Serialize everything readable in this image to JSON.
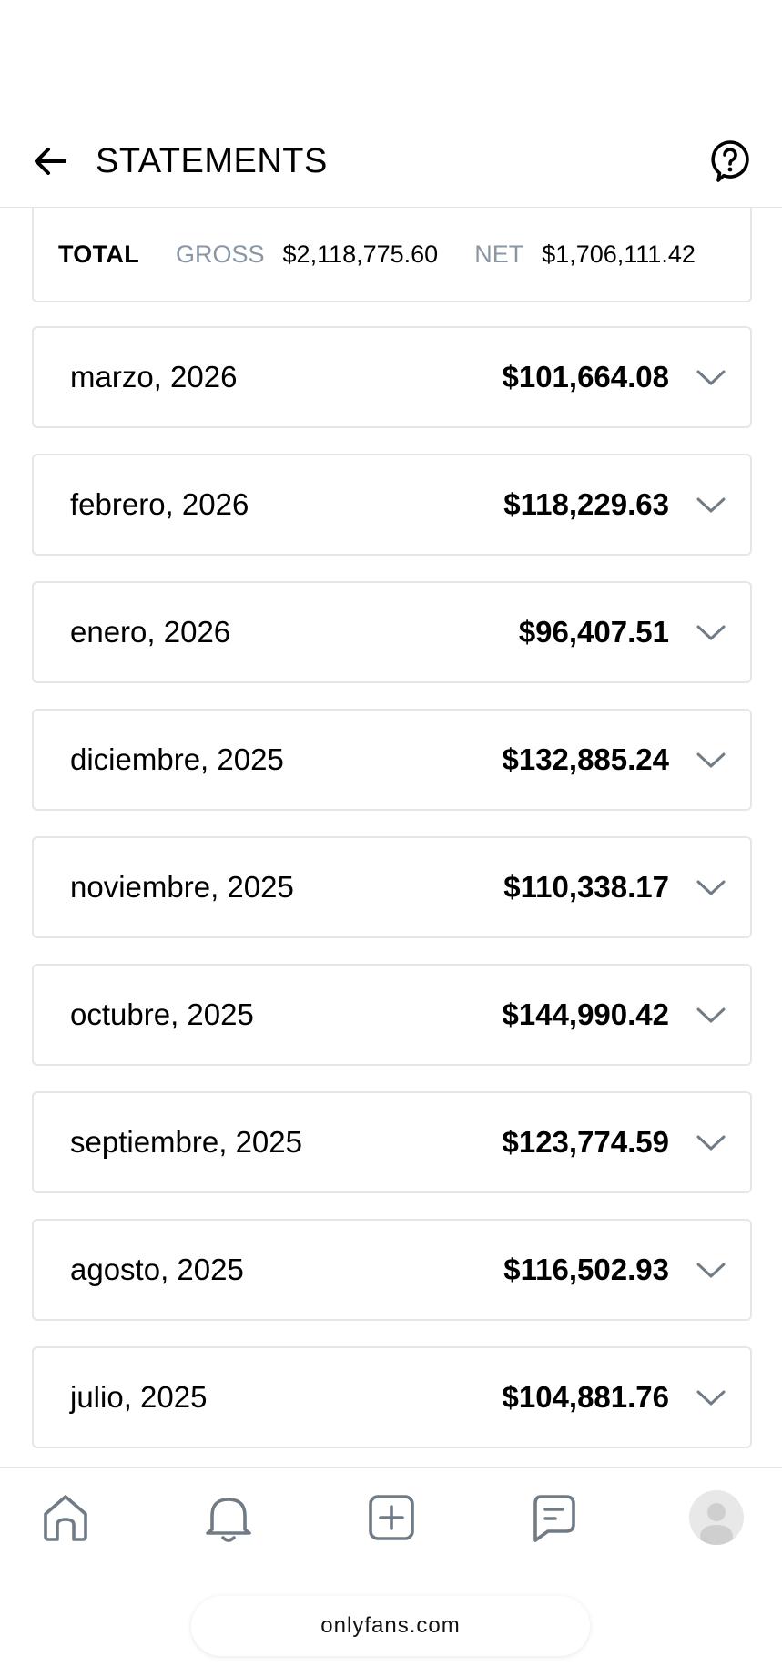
{
  "header": {
    "title": "STATEMENTS",
    "back_icon": "arrow-left-icon",
    "help_icon": "help-circle-icon"
  },
  "total": {
    "label": "TOTAL",
    "gross_label": "GROSS",
    "gross_value": "$2,118,775.60",
    "net_label": "NET",
    "net_value": "$1,706,111.42"
  },
  "statements": [
    {
      "month": "marzo, 2026",
      "amount": "$101,664.08"
    },
    {
      "month": "febrero, 2026",
      "amount": "$118,229.63"
    },
    {
      "month": "enero, 2026",
      "amount": "$96,407.51"
    },
    {
      "month": "diciembre, 2025",
      "amount": "$132,885.24"
    },
    {
      "month": "noviembre, 2025",
      "amount": "$110,338.17"
    },
    {
      "month": "octubre, 2025",
      "amount": "$144,990.42"
    },
    {
      "month": "septiembre, 2025",
      "amount": "$123,774.59"
    },
    {
      "month": "agosto, 2025",
      "amount": "$116,502.93"
    },
    {
      "month": "julio, 2025",
      "amount": "$104,881.76"
    }
  ],
  "nav": {
    "items": [
      "home-icon",
      "bell-icon",
      "add-square-icon",
      "message-icon",
      "avatar"
    ]
  },
  "browser": {
    "url": "onlyfans.com"
  },
  "colors": {
    "text": "#000000",
    "muted": "#8a96a3",
    "border": "#e6e6e6",
    "icon": "#707b85"
  }
}
